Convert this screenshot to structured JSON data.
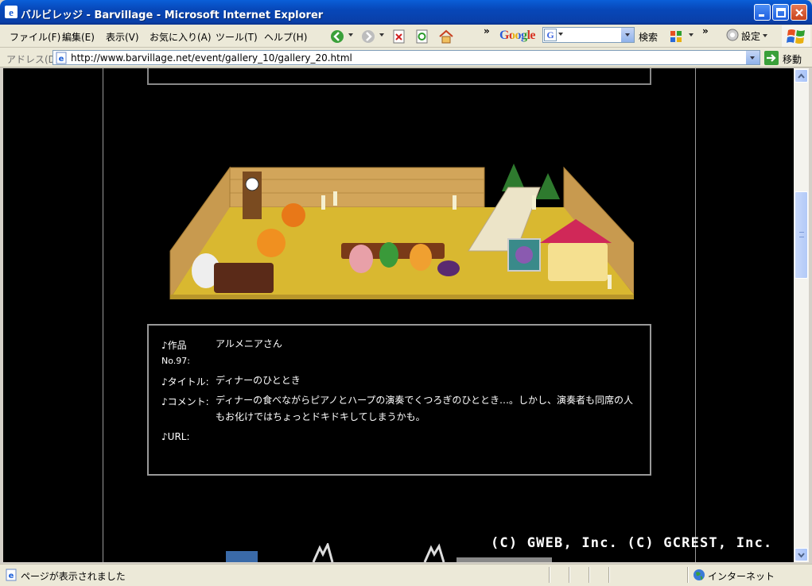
{
  "window": {
    "title": "バルビレッジ - Barvillage - Microsoft Internet Explorer"
  },
  "menu": {
    "file": "ファイル(F)",
    "edit": "編集(E)",
    "view": "表示(V)",
    "favorites": "お気に入り(A)",
    "tools": "ツール(T)",
    "help": "ヘルプ(H)"
  },
  "toolbar": {
    "chevron": "»",
    "google": "Google",
    "google_g": "G",
    "search_label": "検索",
    "chevron2": "»",
    "settings_label": "設定"
  },
  "address": {
    "label": "アドレス(D)",
    "url": "http://www.barvillage.net/event/gallery_10/gallery_20.html",
    "go_label": "移動"
  },
  "content": {
    "work_label": "♪作品",
    "work_no": "No.97:",
    "work_value": "アルメニアさん",
    "title_label": "♪タイトル:",
    "title_value": "ディナーのひととき",
    "comment_label": "♪コメント:",
    "comment_value": "ディナーの食べながらピアノとハープの演奏でくつろぎのひととき…。しかし、演奏者も同席の人もお化けではちょっとドキドキしてしまうかも。",
    "url_label": "♪URL:",
    "copyright": "(C) GWEB, Inc. (C) GCREST, Inc."
  },
  "status": {
    "text": "ページが表示されました",
    "zone": "インターネット"
  },
  "colors": {
    "titlebar": "#0747b8",
    "page_bg": "#000000",
    "floor": "#d9b830",
    "wall": "#d2a55a"
  }
}
